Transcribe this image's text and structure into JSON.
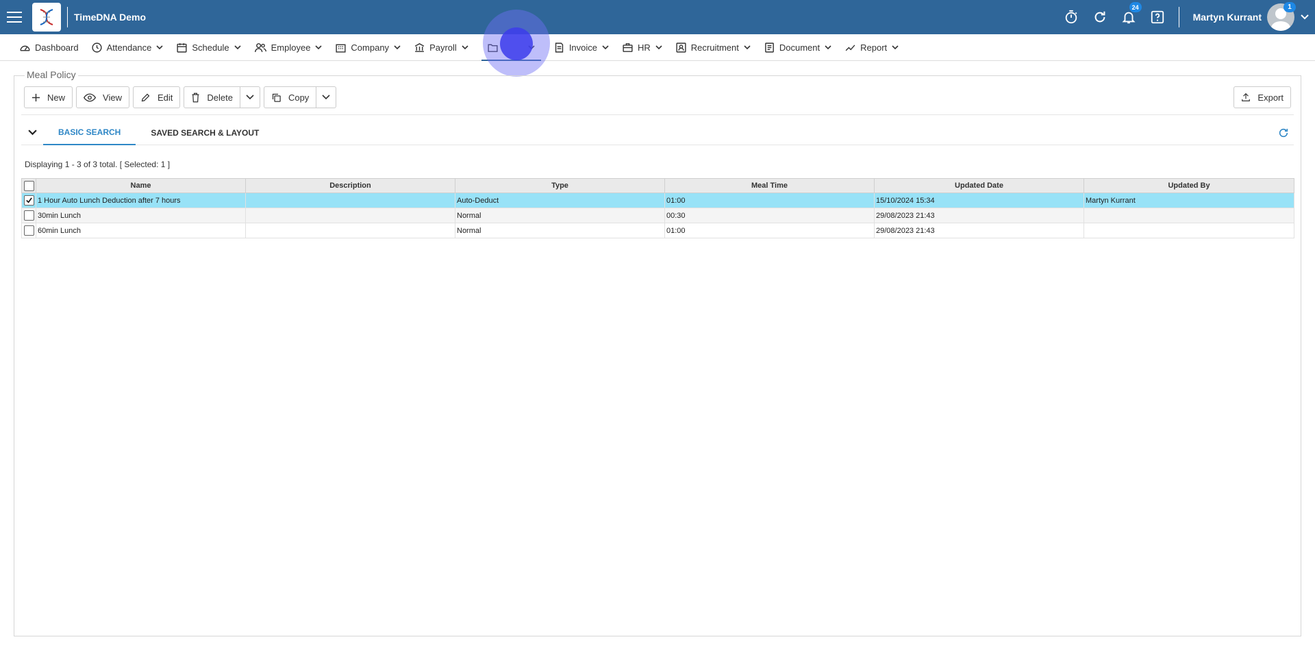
{
  "header": {
    "app_name": "TimeDNA Demo",
    "logo_text": "TimeDNA",
    "notifications_count": "24",
    "user_name": "Martyn Kurrant",
    "user_badge": "1"
  },
  "menu": [
    {
      "label": "Dashboard",
      "icon": "dashboard-icon"
    },
    {
      "label": "Attendance",
      "icon": "clock-icon"
    },
    {
      "label": "Schedule",
      "icon": "calendar-icon"
    },
    {
      "label": "Employee",
      "icon": "people-icon"
    },
    {
      "label": "Company",
      "icon": "building-icon"
    },
    {
      "label": "Payroll",
      "icon": "bank-icon"
    },
    {
      "label": "",
      "icon": "folder-chart-icon"
    },
    {
      "label": "Invoice",
      "icon": "invoice-icon"
    },
    {
      "label": "HR",
      "icon": "briefcase-icon"
    },
    {
      "label": "Recruitment",
      "icon": "id-card-icon"
    },
    {
      "label": "Document",
      "icon": "document-icon"
    },
    {
      "label": "Report",
      "icon": "trend-icon"
    }
  ],
  "panel": {
    "title": "Meal Policy",
    "toolbar": {
      "new": "New",
      "view": "View",
      "edit": "Edit",
      "delete": "Delete",
      "copy": "Copy",
      "export": "Export"
    },
    "tabs": [
      "BASIC SEARCH",
      "SAVED SEARCH & LAYOUT"
    ],
    "summary": "Displaying 1 - 3 of 3 total. [ Selected: 1 ]"
  },
  "grid": {
    "columns": [
      "Name",
      "Description",
      "Type",
      "Meal Time",
      "Updated Date",
      "Updated By"
    ],
    "rows": [
      {
        "checked": true,
        "cells": [
          "1 Hour Auto Lunch Deduction after 7 hours",
          "",
          "Auto-Deduct",
          "01:00",
          "15/10/2024 15:34",
          "Martyn Kurrant"
        ]
      },
      {
        "checked": false,
        "cells": [
          "30min Lunch",
          "",
          "Normal",
          "00:30",
          "29/08/2023 21:43",
          ""
        ]
      },
      {
        "checked": false,
        "cells": [
          "60min Lunch",
          "",
          "Normal",
          "01:00",
          "29/08/2023 21:43",
          ""
        ]
      }
    ]
  },
  "colors": {
    "header_bg": "#2f6699",
    "selected_row": "#98e2f7",
    "tab_active": "#2f87c6",
    "badge": "#1e88e5"
  }
}
